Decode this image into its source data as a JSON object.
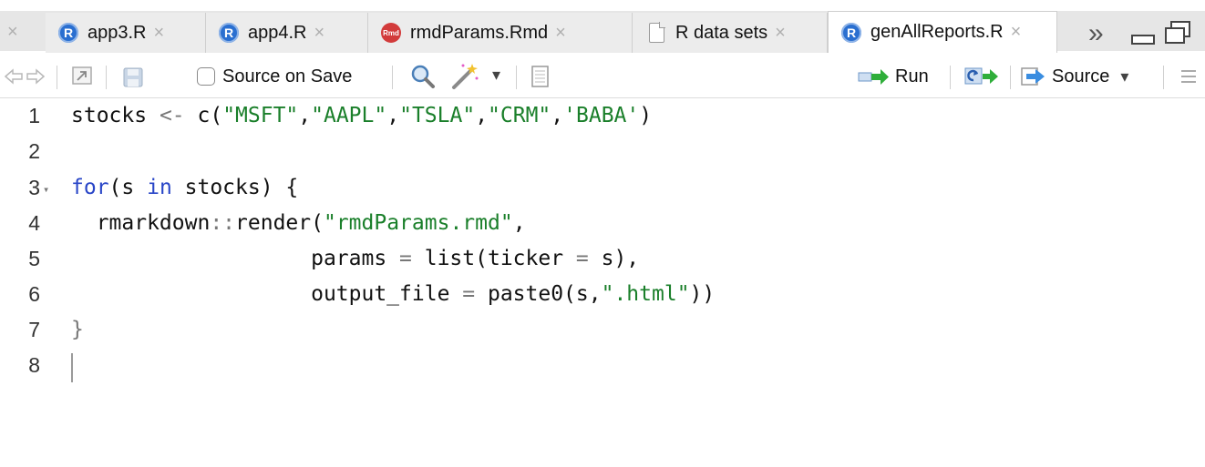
{
  "tabs": [
    {
      "label": "app3.R",
      "icon": "r-file-icon",
      "close": "×"
    },
    {
      "label": "app4.R",
      "icon": "r-file-icon",
      "close": "×"
    },
    {
      "label": "rmdParams.Rmd",
      "icon": "rmd-file-icon",
      "close": "×"
    },
    {
      "label": "R data sets",
      "icon": "document-icon",
      "close": "×"
    },
    {
      "label": "genAllReports.R",
      "icon": "r-file-icon",
      "close": "×",
      "active": true
    }
  ],
  "tab_icons": {
    "r": "R",
    "rmd": "Rmd"
  },
  "left_close": "×",
  "overflow_glyph": "»",
  "toolbar": {
    "source_on_save": "Source on Save",
    "run": "Run",
    "source": "Source",
    "dropdown_glyph": "▾"
  },
  "editor": {
    "line_numbers": [
      "1",
      "2",
      "3",
      "4",
      "5",
      "6",
      "7",
      "8"
    ],
    "fold_glyph": "▾",
    "lines": {
      "l1": {
        "a": "stocks ",
        "op": "<-",
        "b": " c(",
        "s1": "\"MSFT\"",
        "c1": ",",
        "s2": "\"AAPL\"",
        "c2": ",",
        "s3": "\"TSLA\"",
        "c3": ",",
        "s4": "\"CRM\"",
        "c4": ",",
        "s5": "'BABA'",
        "end": ")"
      },
      "l3": {
        "kw1": "for",
        "a": "(s ",
        "kw2": "in",
        "b": " stocks) {"
      },
      "l4": {
        "a": "  rmarkdown",
        "op": "::",
        "b": "render(",
        "s": "\"rmdParams.rmd\"",
        "c": ","
      },
      "l5": {
        "a": "                   params ",
        "op": "=",
        "b": " list(ticker ",
        "op2": "=",
        "c": " s),"
      },
      "l6": {
        "a": "                   output_file ",
        "op": "=",
        "b": " paste0(s,",
        "s": "\".html\"",
        "c": "))"
      },
      "l7": {
        "a": "}"
      }
    }
  },
  "colors": {
    "keyword": "#2845c7",
    "string": "#1a7f2a",
    "operator": "#777777"
  }
}
